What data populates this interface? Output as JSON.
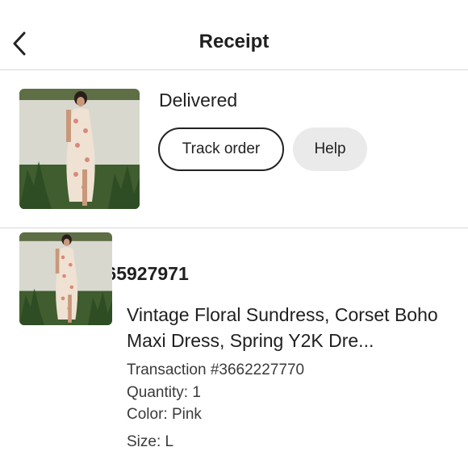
{
  "header": {
    "title": "Receipt",
    "back_icon": "chevron-left-icon"
  },
  "status": {
    "label": "Delivered",
    "track_button": "Track order",
    "help_button": "Help"
  },
  "order": {
    "number_label": "Order #2965927971",
    "item": {
      "title": "Vintage Floral Sundress, Corset Boho Maxi Dress, Spring Y2K Dre...",
      "transaction": "Transaction #3662227770",
      "quantity": "Quantity: 1",
      "color": "Color: Pink",
      "size": "Size: L"
    }
  }
}
